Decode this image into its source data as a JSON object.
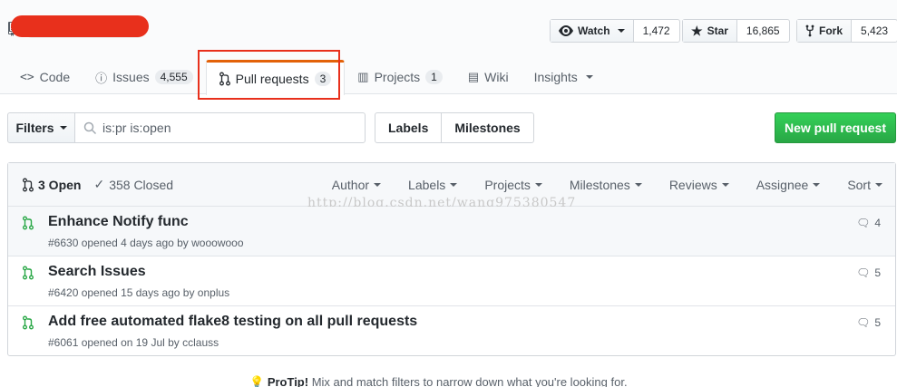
{
  "repo": {
    "name_redacted": ""
  },
  "actions": {
    "watch": {
      "label": "Watch",
      "count": "1,472"
    },
    "star": {
      "label": "Star",
      "count": "16,865"
    },
    "fork": {
      "label": "Fork",
      "count": "5,423"
    }
  },
  "tabs": [
    {
      "label": "Code"
    },
    {
      "label": "Issues",
      "counter": "4,555"
    },
    {
      "label": "Pull requests",
      "counter": "3"
    },
    {
      "label": "Projects",
      "counter": "1"
    },
    {
      "label": "Wiki"
    },
    {
      "label": "Insights"
    }
  ],
  "filters": {
    "button_label": "Filters",
    "search_value": "is:pr is:open",
    "labels_label": "Labels",
    "milestones_label": "Milestones",
    "new_pr_label": "New pull request"
  },
  "list": {
    "open_label": "3 Open",
    "closed_label": "358 Closed",
    "sort_menus": [
      "Author",
      "Labels",
      "Projects",
      "Milestones",
      "Reviews",
      "Assignee",
      "Sort"
    ],
    "watermark": "http://blog.csdn.net/wang975380547",
    "items": [
      {
        "title": "Enhance Notify func",
        "meta": "#6630 opened 4 days ago by wooowooo",
        "comments": "4"
      },
      {
        "title": "Search Issues",
        "meta": "#6420 opened 15 days ago by onplus",
        "comments": "5"
      },
      {
        "title": "Add free automated flake8 testing on all pull requests",
        "meta": "#6061 opened on 19 Jul by cclauss",
        "comments": "5"
      }
    ]
  },
  "protip": {
    "bold": "ProTip!",
    "text": " Mix and match filters to narrow down what you're looking for."
  },
  "colors": {
    "accent_orange": "#e36209",
    "green": "#28a745",
    "highlight_red": "#e8301c"
  }
}
